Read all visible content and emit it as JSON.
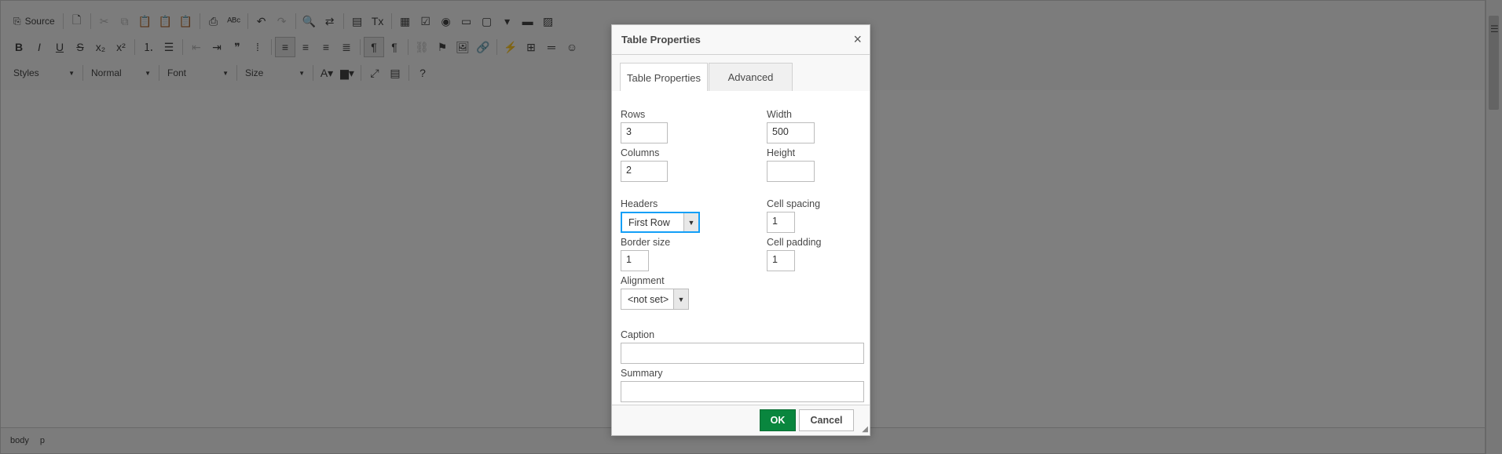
{
  "toolbar": {
    "source_label": "Source",
    "styles_combo": "Styles",
    "format_combo": "Normal",
    "font_combo": "Font",
    "size_combo": "Size"
  },
  "statusbar": {
    "path": [
      "body",
      "p"
    ]
  },
  "dialog": {
    "title": "Table Properties",
    "close_glyph": "×",
    "tabs": [
      "Table Properties",
      "Advanced"
    ],
    "fields": {
      "rows_label": "Rows",
      "rows_value": "3",
      "columns_label": "Columns",
      "columns_value": "2",
      "width_label": "Width",
      "width_value": "500",
      "height_label": "Height",
      "height_value": "",
      "headers_label": "Headers",
      "headers_value": "First Row",
      "cell_spacing_label": "Cell spacing",
      "cell_spacing_value": "1",
      "border_size_label": "Border size",
      "border_size_value": "1",
      "cell_padding_label": "Cell padding",
      "cell_padding_value": "1",
      "alignment_label": "Alignment",
      "alignment_value": "<not set>",
      "caption_label": "Caption",
      "caption_value": "",
      "summary_label": "Summary",
      "summary_value": ""
    },
    "ok_label": "OK",
    "cancel_label": "Cancel"
  },
  "colors": {
    "ok_green": "#09863e",
    "focus_blue": "#139ff7",
    "overlay": "rgba(0,0,0,0.5)"
  }
}
